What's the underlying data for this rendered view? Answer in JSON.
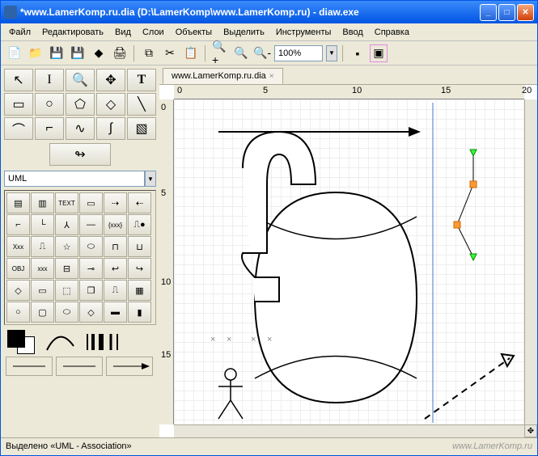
{
  "window": {
    "title": "*www.LamerKomp.ru.dia (D:\\LamerKomp\\www.LamerKomp.ru) - diaw.exe"
  },
  "menu": {
    "file": "Файл",
    "edit": "Редактировать",
    "view": "Вид",
    "layers": "Слои",
    "objects": "Объекты",
    "select": "Выделить",
    "tools": "Инструменты",
    "input": "Ввод",
    "help": "Справка"
  },
  "toolbar": {
    "zoom_value": "100%"
  },
  "sidebar": {
    "category": "UML"
  },
  "tab": {
    "label": "www.LamerKomp.ru.dia",
    "close": "×"
  },
  "ruler": {
    "h": [
      "0",
      "5",
      "10",
      "15",
      "20"
    ],
    "v": [
      "0",
      "5",
      "10",
      "15"
    ]
  },
  "status": {
    "text": "Выделено «UML - Association»",
    "watermark": "www.LamerKomp.ru"
  }
}
